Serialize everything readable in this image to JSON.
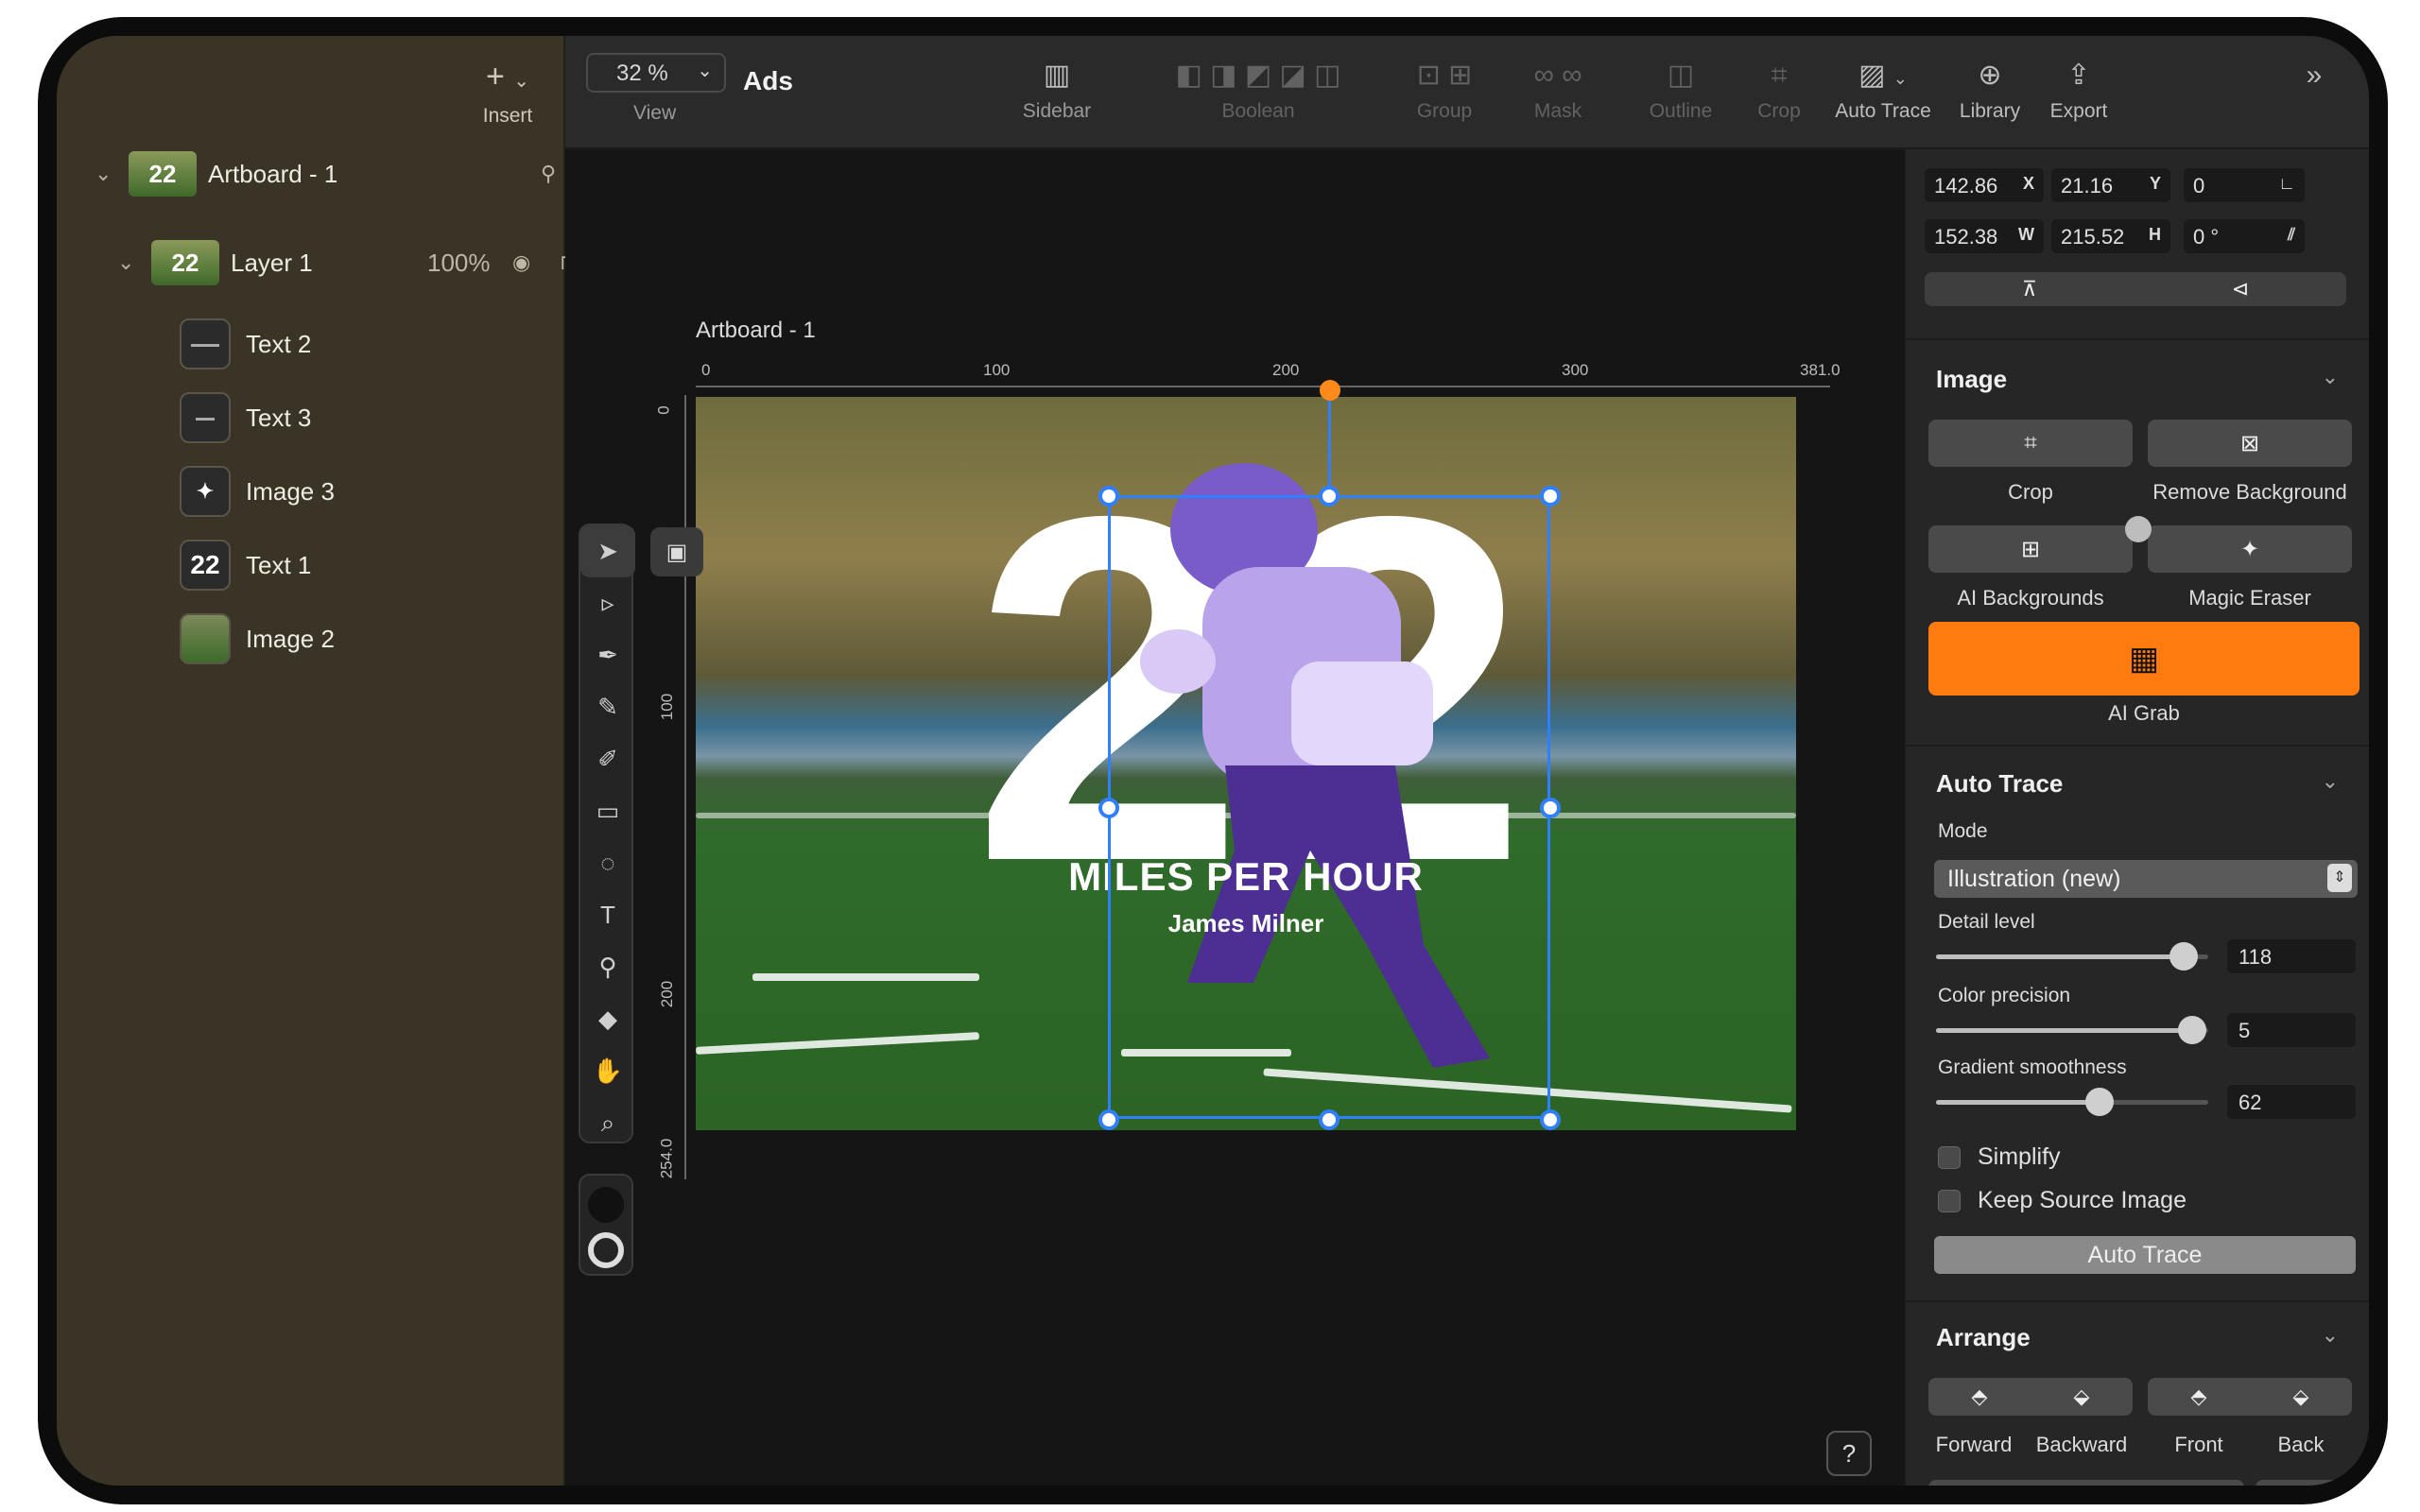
{
  "sidebar": {
    "insert_label": "Insert",
    "artboard": {
      "name": "Artboard - 1",
      "thumb_text": "22"
    },
    "layer": {
      "name": "Layer 1",
      "opacity": "100%",
      "thumb_text": "22"
    },
    "children": [
      {
        "name": "Text 2",
        "icon": "text-thumb"
      },
      {
        "name": "Text 3",
        "icon": "text-thumb"
      },
      {
        "name": "Image 3",
        "icon": "image-thumb"
      },
      {
        "name": "Text 1",
        "icon": "text-thumb",
        "thumb_text": "22"
      },
      {
        "name": "Image 2",
        "icon": "image-thumb"
      }
    ]
  },
  "toolbar": {
    "zoom": "32 %",
    "view_label": "View",
    "doc_title": "Ads",
    "items": [
      "Sidebar",
      "Boolean",
      "Group",
      "Mask",
      "Outline",
      "Crop",
      "Auto Trace",
      "Library",
      "Export"
    ]
  },
  "canvas": {
    "artboard_label": "Artboard - 1",
    "ruler_h": [
      "0",
      "100",
      "200",
      "300",
      "381.0"
    ],
    "ruler_v": [
      "0",
      "100",
      "200",
      "254.0"
    ],
    "big_number": "22",
    "headline": "MILES PER HOUR",
    "subline": "James Milner",
    "help": "?"
  },
  "inspector": {
    "x": "142.86",
    "x_label": "X",
    "y": "21.16",
    "y_label": "Y",
    "angle": "0",
    "w": "152.38",
    "w_label": "W",
    "h": "215.52",
    "h_label": "H",
    "rotation": "0 °",
    "image": {
      "title": "Image",
      "crop": "Crop",
      "remove_bg": "Remove Background",
      "ai_bg": "AI Backgrounds",
      "magic_eraser": "Magic Eraser",
      "ai_grab": "AI Grab"
    },
    "auto_trace": {
      "title": "Auto Trace",
      "mode_label": "Mode",
      "mode_value": "Illustration (new)",
      "detail_label": "Detail level",
      "detail_value": "118",
      "detail_fraction": 0.91,
      "color_label": "Color precision",
      "color_value": "5",
      "color_fraction": 0.94,
      "gradient_label": "Gradient smoothness",
      "gradient_value": "62",
      "gradient_fraction": 0.6,
      "simplify": "Simplify",
      "keep_source": "Keep Source Image",
      "button": "Auto Trace"
    },
    "arrange": {
      "title": "Arrange",
      "forward": "Forward",
      "backward": "Backward",
      "front": "Front",
      "back": "Back"
    }
  },
  "colors": {
    "accent": "#2f7fff",
    "ai_grab": "#ff7a0f",
    "sidebar_bg": "#3a3426"
  }
}
